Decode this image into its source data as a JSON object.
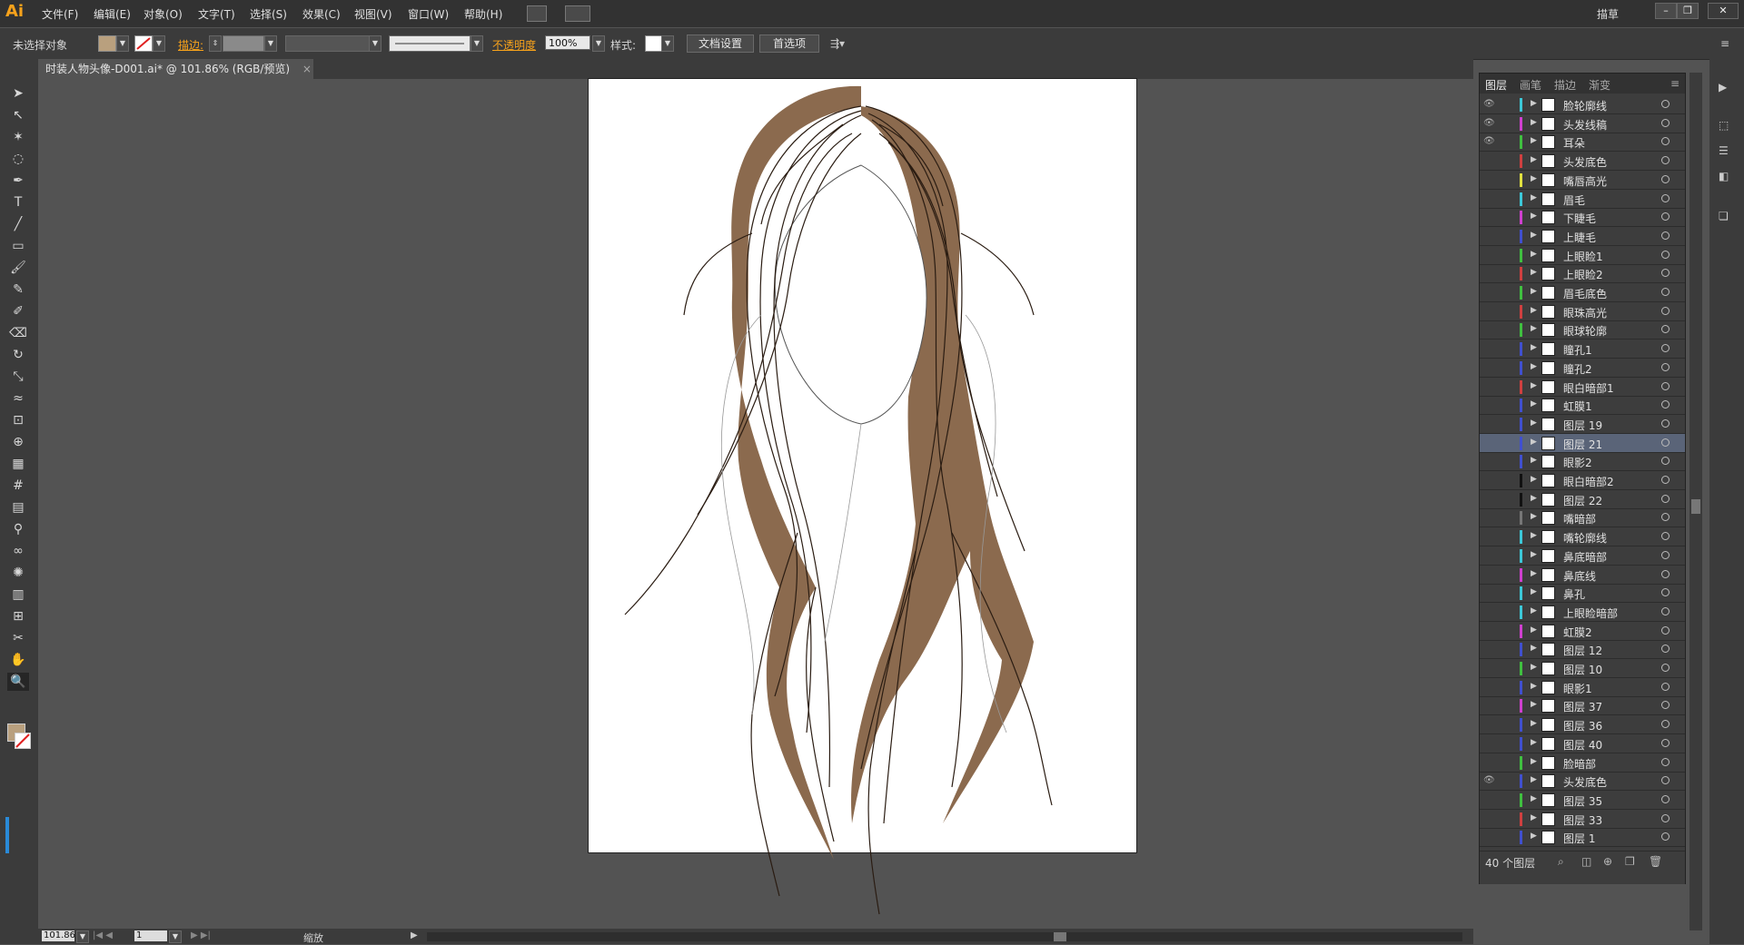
{
  "app": {
    "logo_text": "Ai"
  },
  "menu": [
    "文件(F)",
    "编辑(E)",
    "对象(O)",
    "文字(T)",
    "选择(S)",
    "效果(C)",
    "视图(V)",
    "窗口(W)",
    "帮助(H)"
  ],
  "workspace_label": "描草",
  "control": {
    "selection_status": "未选择对象",
    "stroke_label": "描边:",
    "opacity_label": "不透明度",
    "opacity_value": "100%",
    "style_label": "样式:",
    "doc_settings_button": "文档设置",
    "preferences_button": "首选项"
  },
  "document_tab": {
    "title": "时装人物头像-D001.ai* @ 101.86% (RGB/预览)",
    "close": "×"
  },
  "status": {
    "zoom": "101.86",
    "page": "1",
    "mode": "缩放"
  },
  "layers_panel": {
    "tabs": [
      "图层",
      "画笔",
      "描边",
      "渐变"
    ],
    "layers": [
      {
        "name": "脸轮廓线",
        "color": "#3cc8d8",
        "visible": true
      },
      {
        "name": "头发线稿",
        "color": "#d040d0",
        "visible": true
      },
      {
        "name": "耳朵",
        "color": "#40c040",
        "visible": true
      },
      {
        "name": "头发底色",
        "color": "#d04040",
        "visible": false
      },
      {
        "name": "嘴唇高光",
        "color": "#e0e040",
        "visible": false
      },
      {
        "name": "眉毛",
        "color": "#3cc8d8",
        "visible": false
      },
      {
        "name": "下睫毛",
        "color": "#d040d0",
        "visible": false
      },
      {
        "name": "上睫毛",
        "color": "#4050d0",
        "visible": false
      },
      {
        "name": "上眼睑1",
        "color": "#40c040",
        "visible": false
      },
      {
        "name": "上眼睑2",
        "color": "#d04040",
        "visible": false
      },
      {
        "name": "眉毛底色",
        "color": "#40c040",
        "visible": false
      },
      {
        "name": "眼珠高光",
        "color": "#d04040",
        "visible": false
      },
      {
        "name": "眼球轮廓",
        "color": "#40c040",
        "visible": false
      },
      {
        "name": "瞳孔1",
        "color": "#4050d0",
        "visible": false
      },
      {
        "name": "瞳孔2",
        "color": "#4050d0",
        "visible": false
      },
      {
        "name": "眼白暗部1",
        "color": "#d04040",
        "visible": false
      },
      {
        "name": "虹膜1",
        "color": "#4050d0",
        "visible": false
      },
      {
        "name": "图层 19",
        "color": "#4050d0",
        "visible": false
      },
      {
        "name": "图层 21",
        "color": "#4050d0",
        "visible": false,
        "selected": true
      },
      {
        "name": "眼影2",
        "color": "#4050d0",
        "visible": false
      },
      {
        "name": "眼白暗部2",
        "color": "#111111",
        "visible": false
      },
      {
        "name": "图层 22",
        "color": "#111111",
        "visible": false
      },
      {
        "name": "嘴暗部",
        "color": "#777777",
        "visible": false
      },
      {
        "name": "嘴轮廓线",
        "color": "#3cc8d8",
        "visible": false
      },
      {
        "name": "鼻底暗部",
        "color": "#3cc8d8",
        "visible": false
      },
      {
        "name": "鼻底线",
        "color": "#d040d0",
        "visible": false
      },
      {
        "name": "鼻孔",
        "color": "#3cc8d8",
        "visible": false
      },
      {
        "name": "上眼睑暗部",
        "color": "#3cc8d8",
        "visible": false
      },
      {
        "name": "虹膜2",
        "color": "#d040d0",
        "visible": false
      },
      {
        "name": "图层 12",
        "color": "#4050d0",
        "visible": false
      },
      {
        "name": "图层 10",
        "color": "#40c040",
        "visible": false
      },
      {
        "name": "眼影1",
        "color": "#4050d0",
        "visible": false
      },
      {
        "name": "图层 37",
        "color": "#d040d0",
        "visible": false
      },
      {
        "name": "图层 36",
        "color": "#4050d0",
        "visible": false
      },
      {
        "name": "图层 40",
        "color": "#4050d0",
        "visible": false
      },
      {
        "name": "脸暗部",
        "color": "#40c040",
        "visible": false
      },
      {
        "name": "头发底色",
        "color": "#4050d0",
        "visible": true
      },
      {
        "name": "图层 35",
        "color": "#40c040",
        "visible": false
      },
      {
        "name": "图层 33",
        "color": "#d04040",
        "visible": false
      },
      {
        "name": "图层 1",
        "color": "#4050d0",
        "visible": false
      }
    ],
    "count_label": "40 个图层"
  },
  "colors": {
    "hair": "#8b6a4e",
    "accent": "#f7a21b"
  }
}
